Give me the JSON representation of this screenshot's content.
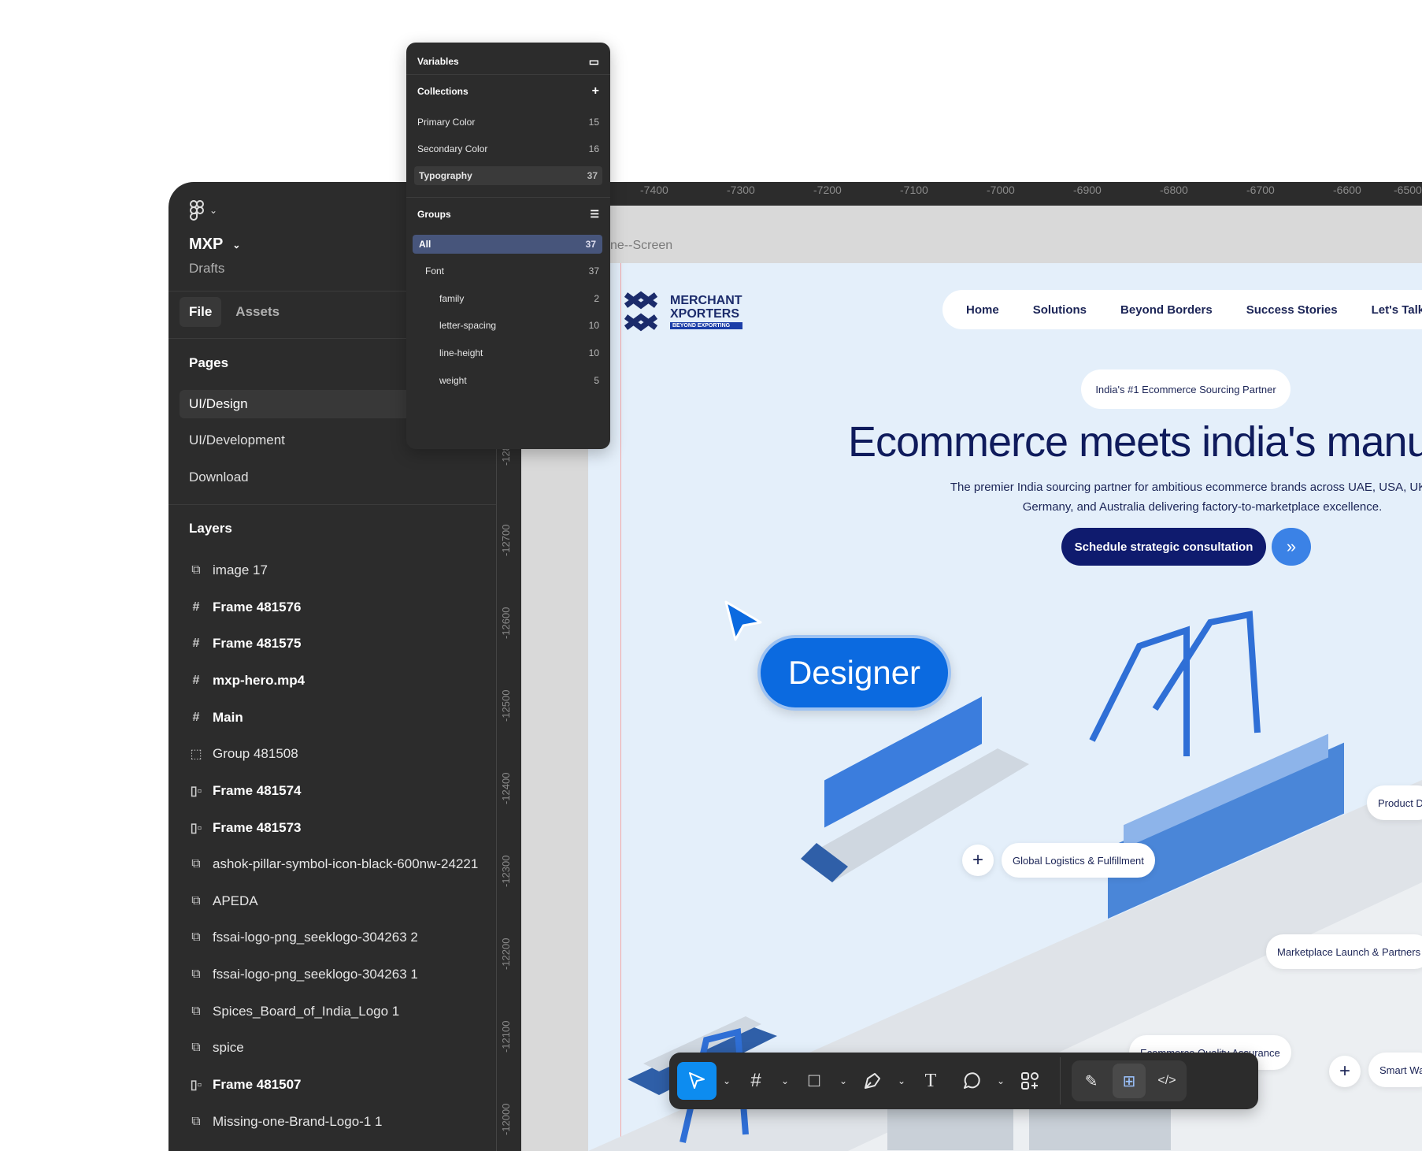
{
  "sidebar": {
    "project": "MXP",
    "drafts": "Drafts",
    "tabs": [
      "File",
      "Assets"
    ],
    "pages_heading": "Pages",
    "pages": [
      "UI/Design",
      "UI/Development",
      "Download"
    ],
    "layers_heading": "Layers",
    "layers": [
      {
        "name": "image 17",
        "icon": "image-icon"
      },
      {
        "name": "Frame 481576",
        "icon": "frame-icon"
      },
      {
        "name": "Frame 481575",
        "icon": "frame-icon"
      },
      {
        "name": "mxp-hero.mp4",
        "icon": "frame-icon"
      },
      {
        "name": "Main",
        "icon": "frame-icon"
      },
      {
        "name": "Group 481508",
        "icon": "group-icon"
      },
      {
        "name": "Frame 481574",
        "icon": "autolayout-icon"
      },
      {
        "name": "Frame 481573",
        "icon": "autolayout-icon"
      },
      {
        "name": "ashok-pillar-symbol-icon-black-600nw-24221",
        "icon": "image-icon"
      },
      {
        "name": "APEDA",
        "icon": "image-icon"
      },
      {
        "name": "fssai-logo-png_seeklogo-304263 2",
        "icon": "image-icon"
      },
      {
        "name": "fssai-logo-png_seeklogo-304263 1",
        "icon": "image-icon"
      },
      {
        "name": "Spices_Board_of_India_Logo 1",
        "icon": "image-icon"
      },
      {
        "name": "spice",
        "icon": "image-icon"
      },
      {
        "name": "Frame 481507",
        "icon": "autolayout-icon"
      },
      {
        "name": "Missing-one-Brand-Logo-1 1",
        "icon": "image-icon"
      }
    ]
  },
  "variables": {
    "title": "Variables",
    "collections_heading": "Collections",
    "collections": [
      {
        "name": "Primary Color",
        "count": "15"
      },
      {
        "name": "Secondary Color",
        "count": "16"
      },
      {
        "name": "Typography",
        "count": "37"
      }
    ],
    "groups_heading": "Groups",
    "groups": [
      {
        "name": "All",
        "count": "37"
      },
      {
        "name": "Font",
        "count": "37"
      },
      {
        "name": "family",
        "count": "2"
      },
      {
        "name": "letter-spacing",
        "count": "10"
      },
      {
        "name": "line-height",
        "count": "10"
      },
      {
        "name": "weight",
        "count": "5"
      }
    ]
  },
  "rulers": {
    "horizontal": [
      "-7400",
      "-7300",
      "-7200",
      "-7100",
      "-7000",
      "-6900",
      "-6800",
      "-6700",
      "-6600",
      "-6500"
    ],
    "vertical": [
      "-128",
      "-12700",
      "-12600",
      "-12500",
      "-12400",
      "-12300",
      "-12200",
      "-12100",
      "-12000"
    ]
  },
  "canvas": {
    "frame_name": "ne--Screen",
    "designer_label": "Designer"
  },
  "website": {
    "logo_line1": "MERCHANT",
    "logo_line2": "XPORTERS",
    "logo_tagline": "BEYOND EXPORTING",
    "nav": [
      "Home",
      "Solutions",
      "Beyond Borders",
      "Success Stories",
      "Let's Talk"
    ],
    "badge": "India's #1 Ecommerce Sourcing Partner",
    "headline": "Ecommerce meets india's manufac",
    "subtext_line1": "The premier India sourcing partner for ambitious ecommerce brands across UAE, USA, UK, Can",
    "subtext_line2": "Germany, and Australia delivering factory-to-marketplace excellence.",
    "cta": "Schedule strategic consultation",
    "tags": {
      "logistics": "Global Logistics & Fulfillment",
      "product": "Product D",
      "marketplace": "Marketplace Launch & Partners",
      "quality": "Ecommerce Quality Assurance",
      "smart": "Smart Wa"
    }
  },
  "colors": {
    "figma_panel": "#2c2c2c",
    "accent": "#0d8cf0",
    "site_bg": "#e4effa",
    "brand_navy": "#0f1b6e",
    "designer_blue": "#0b6ae0"
  }
}
